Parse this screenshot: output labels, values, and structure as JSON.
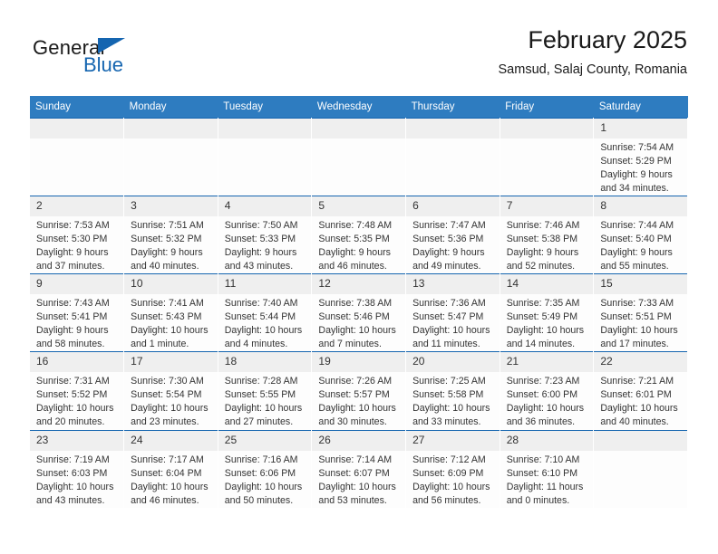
{
  "brand": {
    "name_top": "General",
    "name_bottom": "Blue",
    "accent_color": "#1565b0"
  },
  "header": {
    "title": "February 2025",
    "subtitle": "Samsud, Salaj County, Romania"
  },
  "calendar": {
    "header_bg": "#2e7cc0",
    "row_rule_color": "#1565b0",
    "daynum_bg": "#efefef",
    "weekday_headers": [
      "Sunday",
      "Monday",
      "Tuesday",
      "Wednesday",
      "Thursday",
      "Friday",
      "Saturday"
    ],
    "weeks": [
      [
        {
          "day": "",
          "sunrise": "",
          "sunset": "",
          "daylight_1": "",
          "daylight_2": ""
        },
        {
          "day": "",
          "sunrise": "",
          "sunset": "",
          "daylight_1": "",
          "daylight_2": ""
        },
        {
          "day": "",
          "sunrise": "",
          "sunset": "",
          "daylight_1": "",
          "daylight_2": ""
        },
        {
          "day": "",
          "sunrise": "",
          "sunset": "",
          "daylight_1": "",
          "daylight_2": ""
        },
        {
          "day": "",
          "sunrise": "",
          "sunset": "",
          "daylight_1": "",
          "daylight_2": ""
        },
        {
          "day": "",
          "sunrise": "",
          "sunset": "",
          "daylight_1": "",
          "daylight_2": ""
        },
        {
          "day": "1",
          "sunrise": "Sunrise: 7:54 AM",
          "sunset": "Sunset: 5:29 PM",
          "daylight_1": "Daylight: 9 hours",
          "daylight_2": "and 34 minutes."
        }
      ],
      [
        {
          "day": "2",
          "sunrise": "Sunrise: 7:53 AM",
          "sunset": "Sunset: 5:30 PM",
          "daylight_1": "Daylight: 9 hours",
          "daylight_2": "and 37 minutes."
        },
        {
          "day": "3",
          "sunrise": "Sunrise: 7:51 AM",
          "sunset": "Sunset: 5:32 PM",
          "daylight_1": "Daylight: 9 hours",
          "daylight_2": "and 40 minutes."
        },
        {
          "day": "4",
          "sunrise": "Sunrise: 7:50 AM",
          "sunset": "Sunset: 5:33 PM",
          "daylight_1": "Daylight: 9 hours",
          "daylight_2": "and 43 minutes."
        },
        {
          "day": "5",
          "sunrise": "Sunrise: 7:48 AM",
          "sunset": "Sunset: 5:35 PM",
          "daylight_1": "Daylight: 9 hours",
          "daylight_2": "and 46 minutes."
        },
        {
          "day": "6",
          "sunrise": "Sunrise: 7:47 AM",
          "sunset": "Sunset: 5:36 PM",
          "daylight_1": "Daylight: 9 hours",
          "daylight_2": "and 49 minutes."
        },
        {
          "day": "7",
          "sunrise": "Sunrise: 7:46 AM",
          "sunset": "Sunset: 5:38 PM",
          "daylight_1": "Daylight: 9 hours",
          "daylight_2": "and 52 minutes."
        },
        {
          "day": "8",
          "sunrise": "Sunrise: 7:44 AM",
          "sunset": "Sunset: 5:40 PM",
          "daylight_1": "Daylight: 9 hours",
          "daylight_2": "and 55 minutes."
        }
      ],
      [
        {
          "day": "9",
          "sunrise": "Sunrise: 7:43 AM",
          "sunset": "Sunset: 5:41 PM",
          "daylight_1": "Daylight: 9 hours",
          "daylight_2": "and 58 minutes."
        },
        {
          "day": "10",
          "sunrise": "Sunrise: 7:41 AM",
          "sunset": "Sunset: 5:43 PM",
          "daylight_1": "Daylight: 10 hours",
          "daylight_2": "and 1 minute."
        },
        {
          "day": "11",
          "sunrise": "Sunrise: 7:40 AM",
          "sunset": "Sunset: 5:44 PM",
          "daylight_1": "Daylight: 10 hours",
          "daylight_2": "and 4 minutes."
        },
        {
          "day": "12",
          "sunrise": "Sunrise: 7:38 AM",
          "sunset": "Sunset: 5:46 PM",
          "daylight_1": "Daylight: 10 hours",
          "daylight_2": "and 7 minutes."
        },
        {
          "day": "13",
          "sunrise": "Sunrise: 7:36 AM",
          "sunset": "Sunset: 5:47 PM",
          "daylight_1": "Daylight: 10 hours",
          "daylight_2": "and 11 minutes."
        },
        {
          "day": "14",
          "sunrise": "Sunrise: 7:35 AM",
          "sunset": "Sunset: 5:49 PM",
          "daylight_1": "Daylight: 10 hours",
          "daylight_2": "and 14 minutes."
        },
        {
          "day": "15",
          "sunrise": "Sunrise: 7:33 AM",
          "sunset": "Sunset: 5:51 PM",
          "daylight_1": "Daylight: 10 hours",
          "daylight_2": "and 17 minutes."
        }
      ],
      [
        {
          "day": "16",
          "sunrise": "Sunrise: 7:31 AM",
          "sunset": "Sunset: 5:52 PM",
          "daylight_1": "Daylight: 10 hours",
          "daylight_2": "and 20 minutes."
        },
        {
          "day": "17",
          "sunrise": "Sunrise: 7:30 AM",
          "sunset": "Sunset: 5:54 PM",
          "daylight_1": "Daylight: 10 hours",
          "daylight_2": "and 23 minutes."
        },
        {
          "day": "18",
          "sunrise": "Sunrise: 7:28 AM",
          "sunset": "Sunset: 5:55 PM",
          "daylight_1": "Daylight: 10 hours",
          "daylight_2": "and 27 minutes."
        },
        {
          "day": "19",
          "sunrise": "Sunrise: 7:26 AM",
          "sunset": "Sunset: 5:57 PM",
          "daylight_1": "Daylight: 10 hours",
          "daylight_2": "and 30 minutes."
        },
        {
          "day": "20",
          "sunrise": "Sunrise: 7:25 AM",
          "sunset": "Sunset: 5:58 PM",
          "daylight_1": "Daylight: 10 hours",
          "daylight_2": "and 33 minutes."
        },
        {
          "day": "21",
          "sunrise": "Sunrise: 7:23 AM",
          "sunset": "Sunset: 6:00 PM",
          "daylight_1": "Daylight: 10 hours",
          "daylight_2": "and 36 minutes."
        },
        {
          "day": "22",
          "sunrise": "Sunrise: 7:21 AM",
          "sunset": "Sunset: 6:01 PM",
          "daylight_1": "Daylight: 10 hours",
          "daylight_2": "and 40 minutes."
        }
      ],
      [
        {
          "day": "23",
          "sunrise": "Sunrise: 7:19 AM",
          "sunset": "Sunset: 6:03 PM",
          "daylight_1": "Daylight: 10 hours",
          "daylight_2": "and 43 minutes."
        },
        {
          "day": "24",
          "sunrise": "Sunrise: 7:17 AM",
          "sunset": "Sunset: 6:04 PM",
          "daylight_1": "Daylight: 10 hours",
          "daylight_2": "and 46 minutes."
        },
        {
          "day": "25",
          "sunrise": "Sunrise: 7:16 AM",
          "sunset": "Sunset: 6:06 PM",
          "daylight_1": "Daylight: 10 hours",
          "daylight_2": "and 50 minutes."
        },
        {
          "day": "26",
          "sunrise": "Sunrise: 7:14 AM",
          "sunset": "Sunset: 6:07 PM",
          "daylight_1": "Daylight: 10 hours",
          "daylight_2": "and 53 minutes."
        },
        {
          "day": "27",
          "sunrise": "Sunrise: 7:12 AM",
          "sunset": "Sunset: 6:09 PM",
          "daylight_1": "Daylight: 10 hours",
          "daylight_2": "and 56 minutes."
        },
        {
          "day": "28",
          "sunrise": "Sunrise: 7:10 AM",
          "sunset": "Sunset: 6:10 PM",
          "daylight_1": "Daylight: 11 hours",
          "daylight_2": "and 0 minutes."
        },
        {
          "day": "",
          "sunrise": "",
          "sunset": "",
          "daylight_1": "",
          "daylight_2": ""
        }
      ]
    ]
  }
}
